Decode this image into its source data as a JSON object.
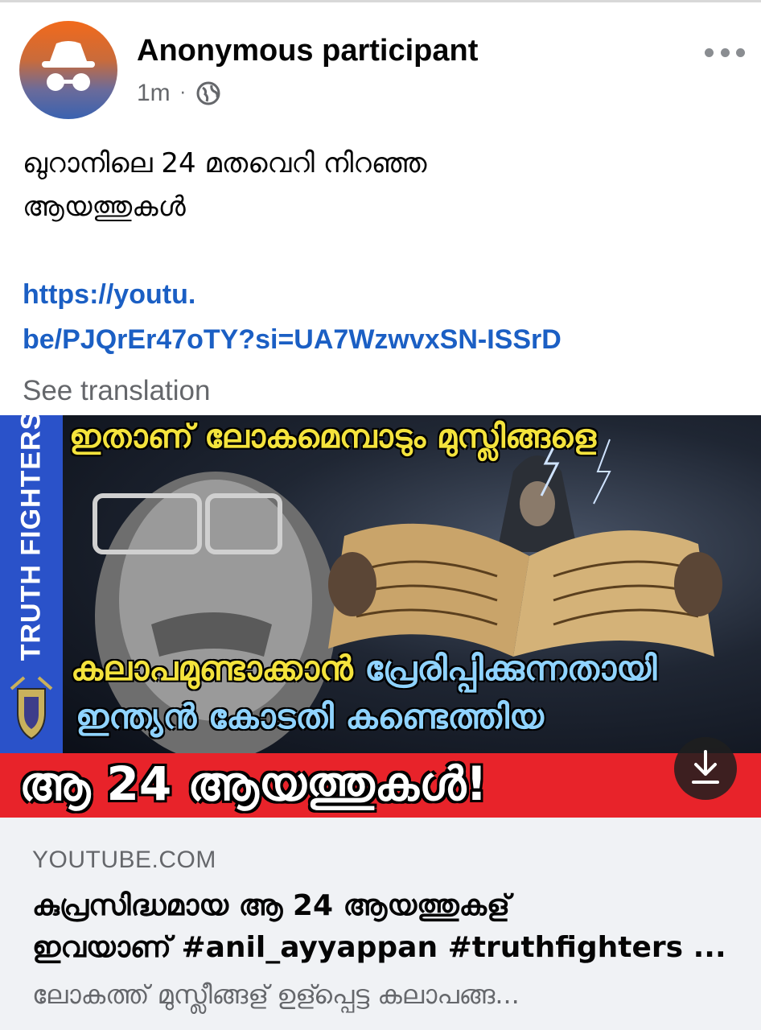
{
  "post": {
    "author": "Anonymous participant",
    "time": "1m",
    "separator": "·",
    "audience_icon": "globe-icon",
    "menu_icon": "more-horizontal-icon",
    "text_line1": "ഖുറാനിലെ 24 മതവെറി നിറഞ്ഞ",
    "text_line2": "ആയത്തുകൾ",
    "link_line1": "https://youtu.",
    "link_line2": "be/PJQrEr47oTY?si=UA7WzwvxSN-ISSrD",
    "see_translation": "See translation"
  },
  "thumbnail": {
    "side_label": "TRUTH FIGHTERS",
    "top_text": "ഇതാണ് ലോകമെമ്പാടും മുസ്ലിങ്ങളെ",
    "mid_text_1a": "കലാപമുണ്ടാക്കാൻ",
    "mid_text_1b": "പ്രേരിപ്പിക്കുന്നതായി",
    "mid_text_2": "ഇന്ത്യൻ കോടതി കണ്ടെത്തിയ",
    "banner_text": "ആ 24 ആയത്തുകൾ!",
    "download_icon": "download-icon"
  },
  "link_preview": {
    "domain": "YOUTUBE.COM",
    "title_line1": "കുപ്രസിദ്ധമായ ആ 24 ആയത്തുകള്",
    "title_line2": "ഇവയാണ് #anil_ayyappan #truthfighters ...",
    "description": "ലോകത്ത് മുസ്ലീങ്ങള് ഉള്പ്പെട്ട കലാപങ്ങ..."
  },
  "colors": {
    "link": "#1b5fc4",
    "secondary_text": "#65676b",
    "card_bg": "#f0f2f5",
    "banner_red": "#e8232a",
    "side_blue": "#2a52c9",
    "thumb_yellow": "#f4e33c"
  }
}
